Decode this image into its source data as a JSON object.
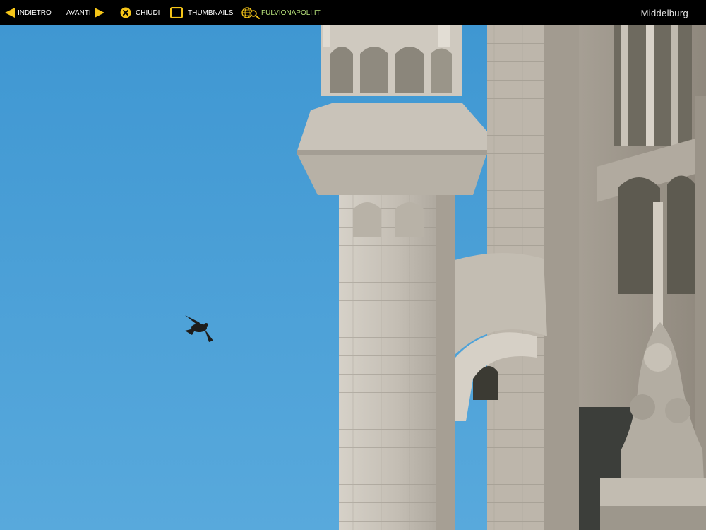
{
  "toolbar": {
    "back_label": "INDIETRO",
    "forward_label": "AVANTI",
    "close_label": "CHIUDI",
    "thumbnails_label": "THUMBNAILS",
    "site_label": "FULVIONAPOLI.IT"
  },
  "gallery": {
    "title": "Middelburg"
  },
  "icons": {
    "back": "arrow-left-icon",
    "forward": "arrow-right-icon",
    "close": "close-circle-icon",
    "thumbnails": "square-outline-icon",
    "site": "globe-search-icon"
  },
  "colors": {
    "accent_yellow": "#f5c518",
    "site_link": "#b6e07a",
    "sky": "#4a9fd5",
    "stone": "#c8c2b8"
  }
}
